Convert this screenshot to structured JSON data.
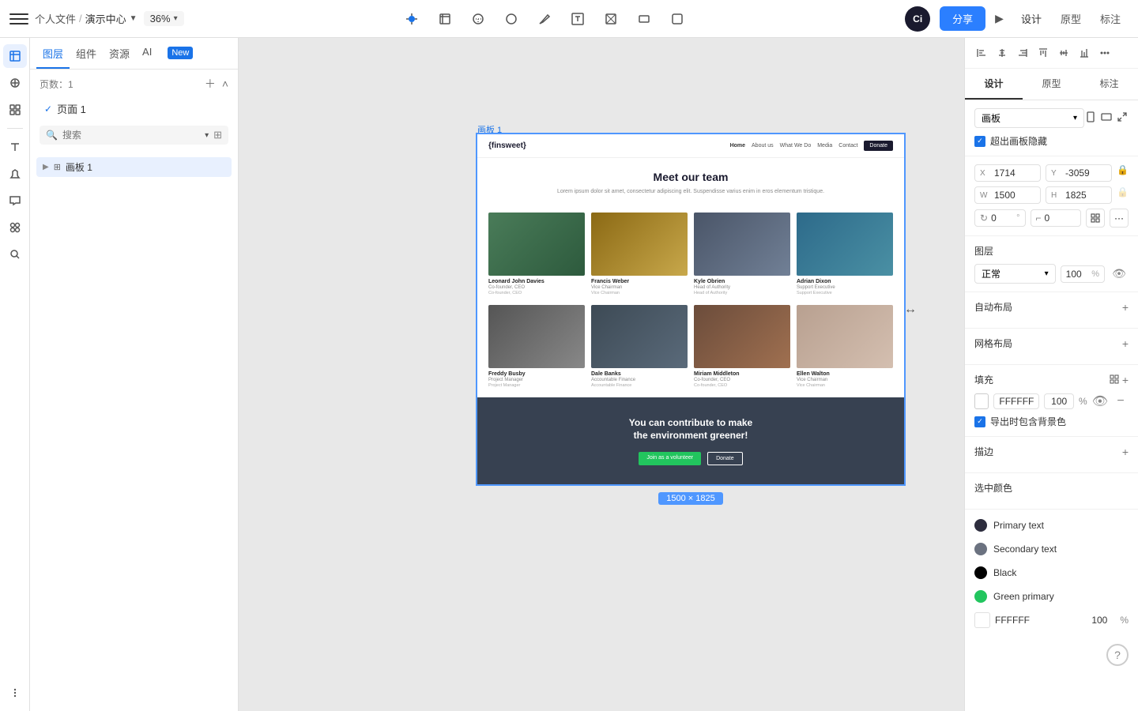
{
  "app": {
    "title": "Ci",
    "breadcrumb": {
      "parent": "个人文件",
      "separator": "/",
      "current": "演示中心",
      "chevron": "▼"
    },
    "zoom": "36%",
    "share_button": "分享",
    "toolbar_tabs": [
      "设计",
      "原型",
      "标注"
    ]
  },
  "left_tabs": [
    "图层",
    "组件",
    "资源",
    "AI",
    "New"
  ],
  "pages_section": {
    "label": "页数：1",
    "pages": [
      "页面 1"
    ]
  },
  "layers_section": {
    "search_placeholder": "搜索",
    "layers": [
      "画板 1"
    ]
  },
  "canvas": {
    "frame_label": "画板 1",
    "size_label": "1500 × 1825",
    "frame_x": "1714",
    "frame_y": "-3059",
    "frame_w": "1500",
    "frame_h": "1825"
  },
  "website": {
    "logo": "{finsweet}",
    "nav_links": [
      "Home",
      "About us",
      "What We Do",
      "Media",
      "Contact"
    ],
    "donate_btn": "Donate",
    "hero_title": "Meet our team",
    "hero_text": "Lorem ipsum dolor sit amet, consectetur adipiscing elit. Suspendisse varius enim in eros elementum tristique.",
    "team": [
      {
        "name": "Leonard John Davies",
        "title": "Co-founder, CEO",
        "desc": "Co-founder, CEO",
        "photo_class": "photo-leonard"
      },
      {
        "name": "Francis Weber",
        "title": "Vice Chairman",
        "desc": "Vice Chairman",
        "photo_class": "photo-francis"
      },
      {
        "name": "Kyle Obrien",
        "title": "Head of Authority",
        "desc": "Head of Authority",
        "photo_class": "photo-kyle"
      },
      {
        "name": "Adrian Dixon",
        "title": "Support Executive",
        "desc": "Support Executive",
        "photo_class": "photo-adrian"
      },
      {
        "name": "Freddy Busby",
        "title": "Project Manager",
        "desc": "Project Manager",
        "photo_class": "photo-freddy"
      },
      {
        "name": "Dale Banks",
        "title": "Accountable Finance",
        "desc": "Accountable Finance",
        "photo_class": "photo-dale"
      },
      {
        "name": "Miriam Middleton",
        "title": "Co-founder, CEO",
        "desc": "Co-founder, CEO",
        "photo_class": "photo-miriam"
      },
      {
        "name": "Ellen Walton",
        "title": "Vice Chairman",
        "desc": "Vice Chairman",
        "photo_class": "photo-ellen"
      }
    ],
    "cta_title": "You can contribute to make\nthe environment greener!",
    "cta_btn1": "Join as a volunteer",
    "cta_btn2": "Donate"
  },
  "right_panel": {
    "tabs": [
      "设计",
      "原型",
      "标注"
    ],
    "frame_section": {
      "title": "画板",
      "overflow_label": "超出画板隐藏"
    },
    "coords": {
      "x_label": "X",
      "x_value": "1714",
      "y_label": "Y",
      "y_value": "-3059",
      "w_label": "W",
      "w_value": "1500",
      "h_label": "H",
      "h_value": "1825"
    },
    "rotation": {
      "label": "0",
      "unit": "°"
    },
    "layer_section": {
      "title": "图层"
    },
    "layer_mode": "正常",
    "layer_opacity": "100",
    "layer_opacity_unit": "%",
    "auto_layout": {
      "title": "自动布局"
    },
    "grid_layout": {
      "title": "网格布局"
    },
    "fill_section": {
      "title": "填充"
    },
    "fill": {
      "hex": "FFFFFF",
      "opacity": "100",
      "unit": "%"
    },
    "export_label": "导出时包含背景色",
    "stroke_section": {
      "title": "描边"
    },
    "selected_colors": {
      "title": "选中颜色",
      "items": [
        {
          "name": "Primary text",
          "color": "#1a1a2e",
          "dot_color": "#2d2d3e"
        },
        {
          "name": "Secondary text",
          "color": "#555",
          "dot_color": "#6b7280"
        },
        {
          "name": "Black",
          "color": "#000",
          "dot_color": "#000000"
        },
        {
          "name": "Green primary",
          "color": "#22c55e",
          "dot_color": "#22c55e"
        }
      ]
    },
    "fill_bottom": {
      "hex": "FFFFFF",
      "opacity": "100",
      "unit": "%"
    }
  },
  "icons": {
    "menu": "☰",
    "play": "▶",
    "move": "✥",
    "frame": "⬜",
    "shape": "◯",
    "pen": "✏",
    "text": "T",
    "brush": "🖌",
    "comment": "💬",
    "component": "⊞",
    "search": "🔍",
    "align_left": "⫡",
    "align_center": "⫢",
    "align_right": "⫣",
    "align_top": "⫠",
    "align_middle": "⫟",
    "align_bottom": "⫞",
    "distribute": "⋯",
    "add": "+",
    "minus": "−",
    "eye": "👁",
    "more": "···",
    "chevron_down": "▾",
    "expand": "⤡",
    "lock": "🔒",
    "refresh": "↻"
  }
}
